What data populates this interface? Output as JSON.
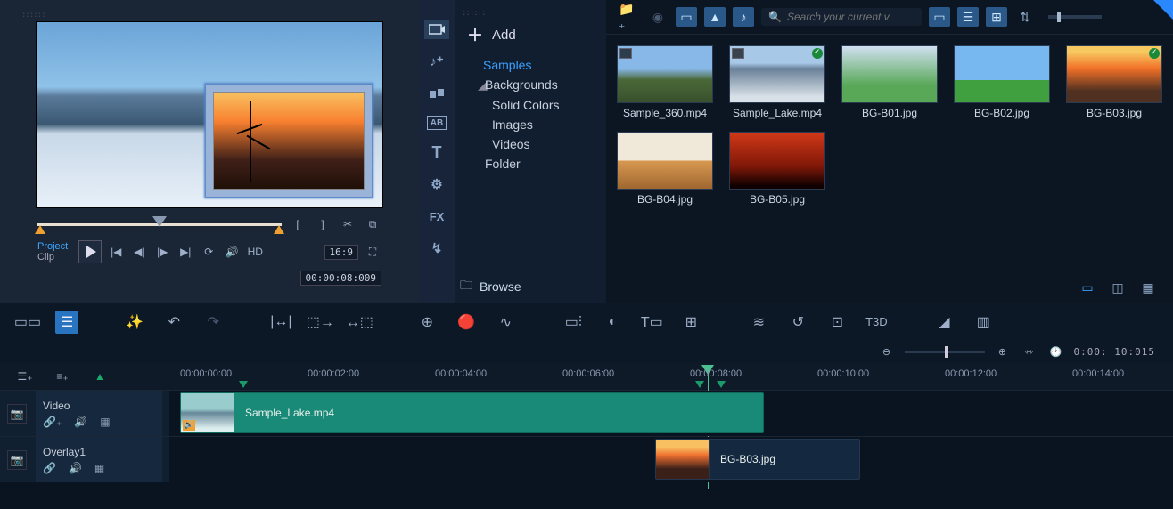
{
  "preview": {
    "mode_project": "Project",
    "mode_clip": "Clip",
    "hd_label": "HD",
    "ratio_label": "16:9",
    "timecode": "00:00:08:009"
  },
  "library": {
    "add_label": "Add",
    "browse_label": "Browse",
    "tree": {
      "samples": "Samples",
      "backgrounds": "Backgrounds",
      "solid_colors": "Solid Colors",
      "images": "Images",
      "videos": "Videos",
      "folder": "Folder"
    },
    "search_placeholder": "Search your current v",
    "cat_fx": "FX",
    "cat_ab": "AB",
    "cat_t": "T",
    "thumbs": [
      {
        "label": "Sample_360.mp4",
        "bg": "bg-360",
        "media": true
      },
      {
        "label": "Sample_Lake.mp4",
        "bg": "bg-lake",
        "media": true,
        "check": true
      },
      {
        "label": "BG-B01.jpg",
        "bg": "bg-b01"
      },
      {
        "label": "BG-B02.jpg",
        "bg": "bg-b02"
      },
      {
        "label": "BG-B03.jpg",
        "bg": "bg-b03",
        "check": true
      },
      {
        "label": "BG-B04.jpg",
        "bg": "bg-b04"
      },
      {
        "label": "BG-B05.jpg",
        "bg": "bg-b05"
      }
    ]
  },
  "mid_toolbar": {
    "t3d": "T3D"
  },
  "zoom_row": {
    "timecode": "0:00: 10:015"
  },
  "timeline": {
    "ticks": [
      "00:00:00:00",
      "00:00:02:00",
      "00:00:04:00",
      "00:00:06:00",
      "00:00:08:00",
      "00:00:10:00",
      "00:00:12:00",
      "00:00:14:00"
    ],
    "tracks": {
      "video": {
        "name": "Video",
        "clip_label": "Sample_Lake.mp4"
      },
      "overlay": {
        "name": "Overlay1",
        "clip_label": "BG-B03.jpg"
      }
    }
  }
}
